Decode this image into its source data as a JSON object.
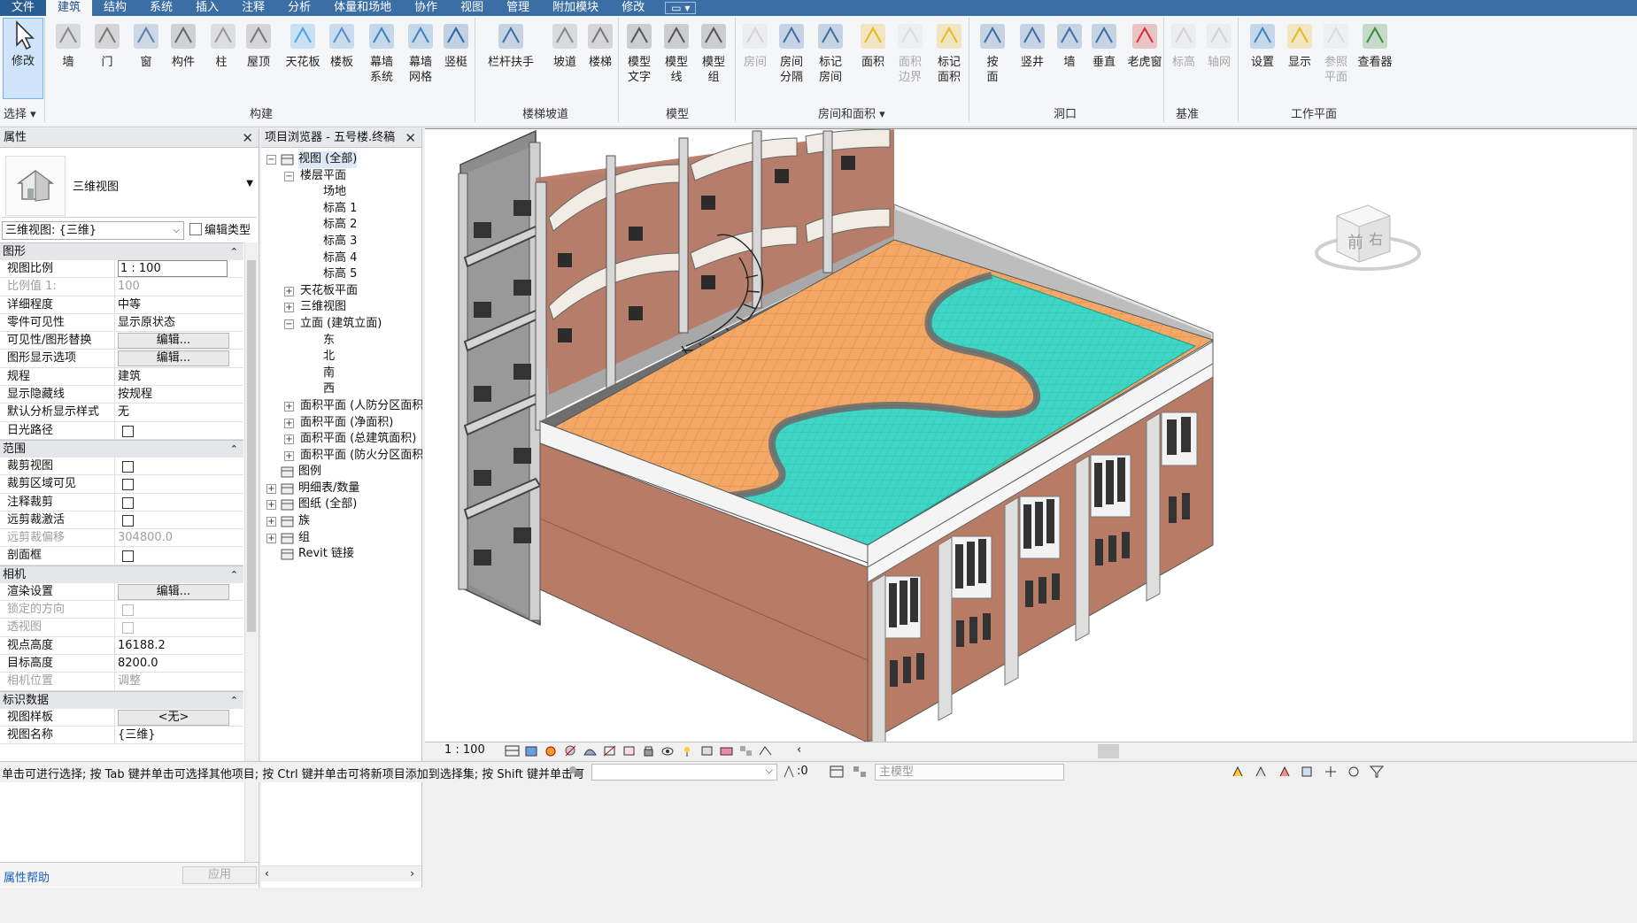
{
  "menu": {
    "items": [
      "文件",
      "建筑",
      "结构",
      "系统",
      "插入",
      "注释",
      "分析",
      "体量和场地",
      "协作",
      "视图",
      "管理",
      "附加模块",
      "修改"
    ],
    "active_index": 1,
    "qat_glyph": "▭ ▾"
  },
  "ribbon": {
    "tools": [
      {
        "label": "修改",
        "icon": "cursor-icon"
      },
      {
        "label": "墙",
        "icon": "wall-icon"
      },
      {
        "label": "门",
        "icon": "door-icon"
      },
      {
        "label": "窗",
        "icon": "window-icon"
      },
      {
        "label": "构件",
        "icon": "component-icon"
      },
      {
        "label": "柱",
        "icon": "column-icon"
      },
      {
        "label": "屋顶",
        "icon": "roof-icon"
      },
      {
        "label": "天花板",
        "icon": "ceiling-icon"
      },
      {
        "label": "楼板",
        "icon": "floor-icon"
      },
      {
        "label": "幕墙\n系统",
        "icon": "curtain-system-icon"
      },
      {
        "label": "幕墙\n网格",
        "icon": "curtain-grid-icon"
      },
      {
        "label": "竖梃",
        "icon": "mullion-icon"
      },
      {
        "label": "栏杆扶手",
        "icon": "railing-icon"
      },
      {
        "label": "坡道",
        "icon": "ramp-icon"
      },
      {
        "label": "楼梯",
        "icon": "stair-icon"
      },
      {
        "label": "模型\n文字",
        "icon": "model-text-icon"
      },
      {
        "label": "模型\n线",
        "icon": "model-line-icon"
      },
      {
        "label": "模型\n组",
        "icon": "model-group-icon"
      },
      {
        "label": "房间",
        "icon": "room-icon",
        "disabled": true
      },
      {
        "label": "房间\n分隔",
        "icon": "room-separator-icon"
      },
      {
        "label": "标记\n房间",
        "icon": "tag-room-icon"
      },
      {
        "label": "面积",
        "icon": "area-icon"
      },
      {
        "label": "面积\n边界",
        "icon": "area-boundary-icon",
        "disabled": true
      },
      {
        "label": "标记\n面积",
        "icon": "tag-area-icon"
      },
      {
        "label": "按\n面",
        "icon": "by-face-icon"
      },
      {
        "label": "竖井",
        "icon": "shaft-icon"
      },
      {
        "label": "墙",
        "icon": "wall-opening-icon"
      },
      {
        "label": "垂直",
        "icon": "vertical-opening-icon"
      },
      {
        "label": "老虎窗",
        "icon": "dormer-icon"
      },
      {
        "label": "标高",
        "icon": "level-icon",
        "disabled": true
      },
      {
        "label": "轴网",
        "icon": "grid-icon",
        "disabled": true
      },
      {
        "label": "设置",
        "icon": "set-workplane-icon"
      },
      {
        "label": "显示",
        "icon": "show-workplane-icon"
      },
      {
        "label": "参照\n平面",
        "icon": "ref-plane-icon",
        "disabled": true
      },
      {
        "label": "查看器",
        "icon": "viewer-icon"
      }
    ],
    "groups": [
      "选择 ▾",
      "构建",
      "楼梯坡道",
      "模型",
      "房间和面积 ▾",
      "洞口",
      "基准",
      "工作平面"
    ]
  },
  "properties": {
    "title": "属性",
    "type_name": "三维视图",
    "selector_value": "三维视图: {三维}",
    "edit_type": "编辑类型",
    "sections": [
      {
        "title": "图形",
        "rows": [
          {
            "k": "视图比例",
            "v": "1 : 100",
            "kind": "input"
          },
          {
            "k": "比例值 1:",
            "v": "100",
            "dis": true
          },
          {
            "k": "详细程度",
            "v": "中等"
          },
          {
            "k": "零件可见性",
            "v": "显示原状态"
          },
          {
            "k": "可见性/图形替换",
            "v": "编辑...",
            "kind": "button"
          },
          {
            "k": "图形显示选项",
            "v": "编辑...",
            "kind": "button"
          },
          {
            "k": "规程",
            "v": "建筑"
          },
          {
            "k": "显示隐藏线",
            "v": "按规程"
          },
          {
            "k": "默认分析显示样式",
            "v": "无"
          },
          {
            "k": "日光路径",
            "kind": "checkbox"
          }
        ]
      },
      {
        "title": "范围",
        "rows": [
          {
            "k": "裁剪视图",
            "kind": "checkbox"
          },
          {
            "k": "裁剪区域可见",
            "kind": "checkbox"
          },
          {
            "k": "注释裁剪",
            "kind": "checkbox"
          },
          {
            "k": "远剪裁激活",
            "kind": "checkbox"
          },
          {
            "k": "远剪裁偏移",
            "v": "304800.0",
            "dis": true
          },
          {
            "k": "剖面框",
            "kind": "checkbox"
          }
        ]
      },
      {
        "title": "相机",
        "rows": [
          {
            "k": "渲染设置",
            "v": "编辑...",
            "kind": "button"
          },
          {
            "k": "锁定的方向",
            "kind": "checkbox",
            "dis": true
          },
          {
            "k": "透视图",
            "kind": "checkbox",
            "dis": true
          },
          {
            "k": "视点高度",
            "v": "16188.2"
          },
          {
            "k": "目标高度",
            "v": "8200.0"
          },
          {
            "k": "相机位置",
            "v": "调整",
            "dis": true
          }
        ]
      },
      {
        "title": "标识数据",
        "rows": [
          {
            "k": "视图样板",
            "v": "<无>",
            "kind": "button"
          },
          {
            "k": "视图名称",
            "v": "{三维}"
          }
        ]
      }
    ],
    "help": "属性帮助",
    "apply": "应用"
  },
  "browser": {
    "title": "项目浏览器 - 五号楼.终稿",
    "nodes": [
      {
        "t": "视图 (全部)",
        "d": 0,
        "tg": "−",
        "icon": "views-icon"
      },
      {
        "t": "楼层平面",
        "d": 1,
        "tg": "−"
      },
      {
        "t": "场地",
        "d": 2
      },
      {
        "t": "标高 1",
        "d": 2
      },
      {
        "t": "标高 2",
        "d": 2
      },
      {
        "t": "标高 3",
        "d": 2
      },
      {
        "t": "标高 4",
        "d": 2
      },
      {
        "t": "标高 5",
        "d": 2
      },
      {
        "t": "天花板平面",
        "d": 1,
        "tg": "+"
      },
      {
        "t": "三维视图",
        "d": 1,
        "tg": "+"
      },
      {
        "t": "立面 (建筑立面)",
        "d": 1,
        "tg": "−"
      },
      {
        "t": "东",
        "d": 2
      },
      {
        "t": "北",
        "d": 2
      },
      {
        "t": "南",
        "d": 2
      },
      {
        "t": "西",
        "d": 2
      },
      {
        "t": "面积平面 (人防分区面积)",
        "d": 1,
        "tg": "+"
      },
      {
        "t": "面积平面 (净面积)",
        "d": 1,
        "tg": "+"
      },
      {
        "t": "面积平面 (总建筑面积)",
        "d": 1,
        "tg": "+"
      },
      {
        "t": "面积平面 (防火分区面积)",
        "d": 1,
        "tg": "+"
      },
      {
        "t": "图例",
        "d": 0,
        "icon": "legend-icon"
      },
      {
        "t": "明细表/数量",
        "d": 0,
        "tg": "+",
        "icon": "schedule-icon"
      },
      {
        "t": "图纸 (全部)",
        "d": 0,
        "tg": "+",
        "icon": "sheets-icon"
      },
      {
        "t": "族",
        "d": 0,
        "tg": "+",
        "icon": "families-icon"
      },
      {
        "t": "组",
        "d": 0,
        "tg": "+",
        "icon": "groups-icon"
      },
      {
        "t": "Revit 链接",
        "d": 0,
        "icon": "revit-link-icon"
      }
    ]
  },
  "viewcube": {
    "front": "前",
    "right": "右"
  },
  "view_control": {
    "scale": "1 : 100"
  },
  "status": {
    "message": "单击可进行选择; 按 Tab 键并单击可选择其他项目; 按 Ctrl 键并单击可将新项目添加到选择集; 按 Shift 键并单击可",
    "zero": ":0",
    "model": "主模型"
  },
  "colors": {
    "brick": "#b77b66",
    "pool": "#3fd6c6",
    "deck": "#f3a865",
    "concrete": "#8d8d8d",
    "ribbon_blue": "#3b6ea5"
  }
}
